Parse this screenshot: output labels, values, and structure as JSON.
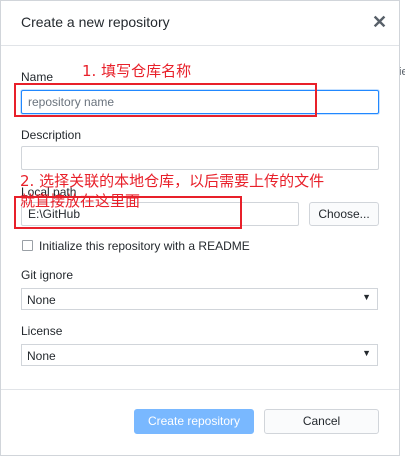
{
  "dialog": {
    "title": "Create a new repository",
    "close_glyph": "✕"
  },
  "form": {
    "name_label": "Name",
    "name_placeholder": "repository name",
    "description_label": "Description",
    "description_value": "",
    "local_path_label": "Local path",
    "local_path_value": "E:\\GitHub",
    "choose_button": "Choose...",
    "init_readme_label": "Initialize this repository with a README",
    "init_readme_checked": false,
    "gitignore_label": "Git ignore",
    "gitignore_value": "None",
    "license_label": "License",
    "license_value": "None",
    "caret_glyph": "▼"
  },
  "footer": {
    "create_button": "Create repository",
    "cancel_button": "Cancel"
  },
  "annotations": {
    "step1": "1. 填写仓库名称",
    "step2_line1": "2. 选择关联的本地仓库，以后需要上传的文件",
    "step2_line2": "就直接放在这里面"
  },
  "background_fragment": "ie",
  "colors": {
    "annotation_red": "#e8202a",
    "primary_button": "#79b8ff",
    "focus_blue": "#2188ff"
  },
  "icons": {
    "close": "close-icon",
    "dropdown": "chevron-down-icon"
  }
}
